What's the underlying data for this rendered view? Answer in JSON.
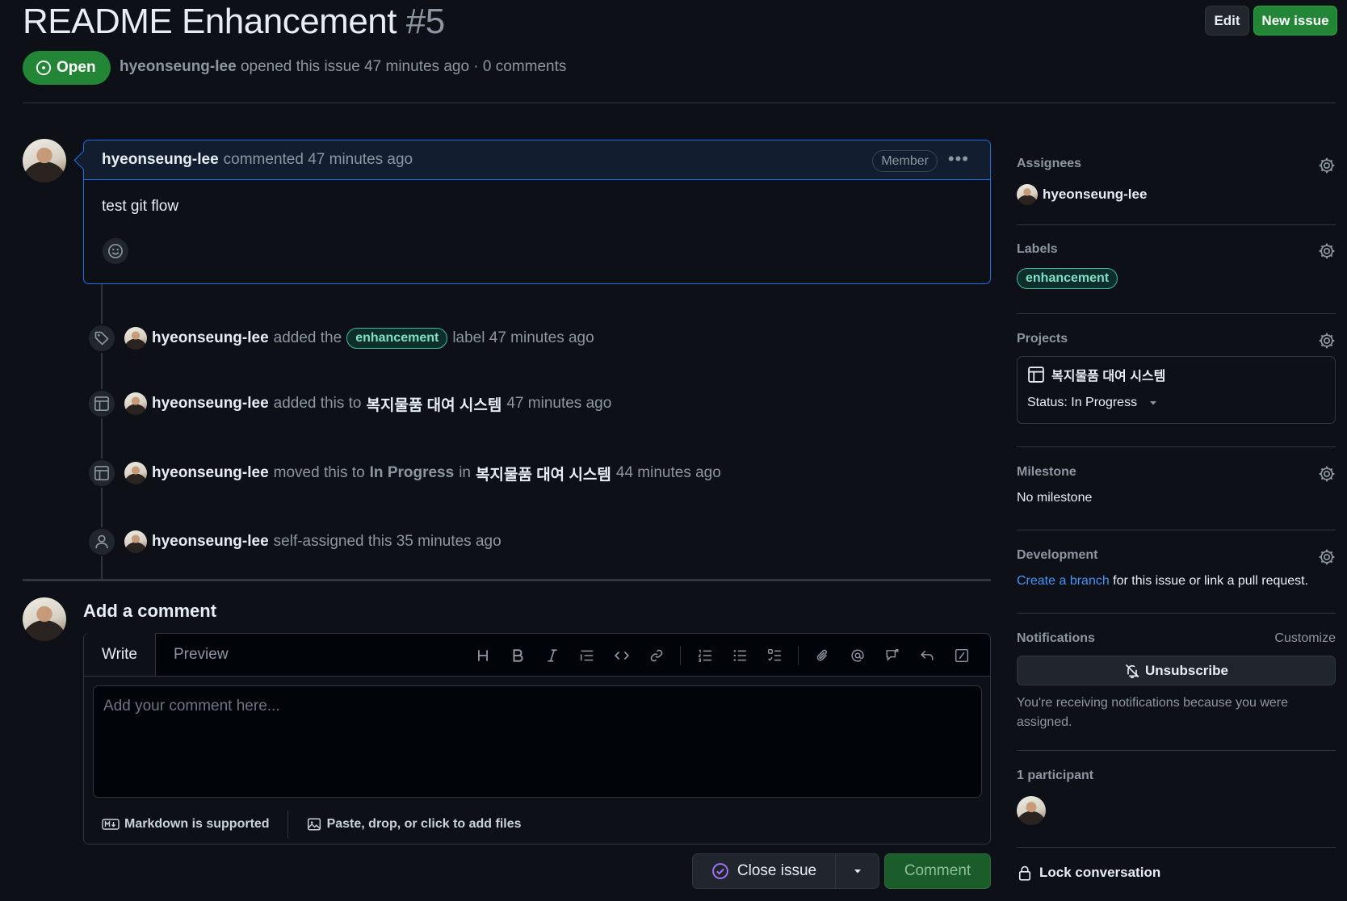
{
  "issue": {
    "title": "README Enhancement",
    "number": "#5",
    "state": "Open",
    "author": "hyeonseung-lee",
    "opened_text": "opened this issue 47 minutes ago · 0 comments"
  },
  "header": {
    "edit_label": "Edit",
    "new_issue_label": "New issue"
  },
  "comment": {
    "author": "hyeonseung-lee",
    "meta": "commented 47 minutes ago",
    "role_badge": "Member",
    "body": "test git flow"
  },
  "timeline": [
    {
      "icon": "tag-icon",
      "actor": "hyeonseung-lee",
      "pre": "added the",
      "label": "enhancement",
      "post": "label 47 minutes ago"
    },
    {
      "icon": "table-icon",
      "actor": "hyeonseung-lee",
      "pre": "added this to",
      "project": "복지물품 대여 시스템",
      "post": "47 minutes ago"
    },
    {
      "icon": "table-icon",
      "actor": "hyeonseung-lee",
      "pre": "moved this to",
      "status": "In Progress",
      "mid": "in",
      "project": "복지물품 대여 시스템",
      "post": "44 minutes ago"
    },
    {
      "icon": "person-icon",
      "actor": "hyeonseung-lee",
      "pre": "self-assigned this 35 minutes ago"
    }
  ],
  "add_comment": {
    "heading": "Add a comment",
    "tab_write": "Write",
    "tab_preview": "Preview",
    "placeholder": "Add your comment here...",
    "markdown_note": "Markdown is supported",
    "files_note": "Paste, drop, or click to add files",
    "close_label": "Close issue",
    "comment_label": "Comment",
    "toolbar_icons": [
      "heading-icon",
      "bold-icon",
      "italic-icon",
      "quote-icon",
      "code-icon",
      "link-icon",
      "ordered-list-icon",
      "unordered-list-icon",
      "task-list-icon",
      "attach-icon",
      "mention-icon",
      "cross-reference-icon",
      "reply-icon",
      "slash-command-icon"
    ]
  },
  "sidebar": {
    "assignees": {
      "title": "Assignees",
      "user": "hyeonseung-lee"
    },
    "labels": {
      "title": "Labels",
      "label": "enhancement"
    },
    "projects": {
      "title": "Projects",
      "name": "복지물품 대여 시스템",
      "status": "Status: In Progress"
    },
    "milestone": {
      "title": "Milestone",
      "value": "No milestone"
    },
    "development": {
      "title": "Development",
      "link": "Create a branch",
      "rest": " for this issue or link a pull request."
    },
    "notifications": {
      "title": "Notifications",
      "customize": "Customize",
      "unsubscribe": "Unsubscribe",
      "reason": "You're receiving notifications because you were assigned."
    },
    "participants": {
      "title": "1 participant"
    },
    "lock": "Lock conversation"
  },
  "colors": {
    "accent_green": "#238636",
    "accent_blue": "#1f6feb",
    "label": "#7ee0c9"
  }
}
